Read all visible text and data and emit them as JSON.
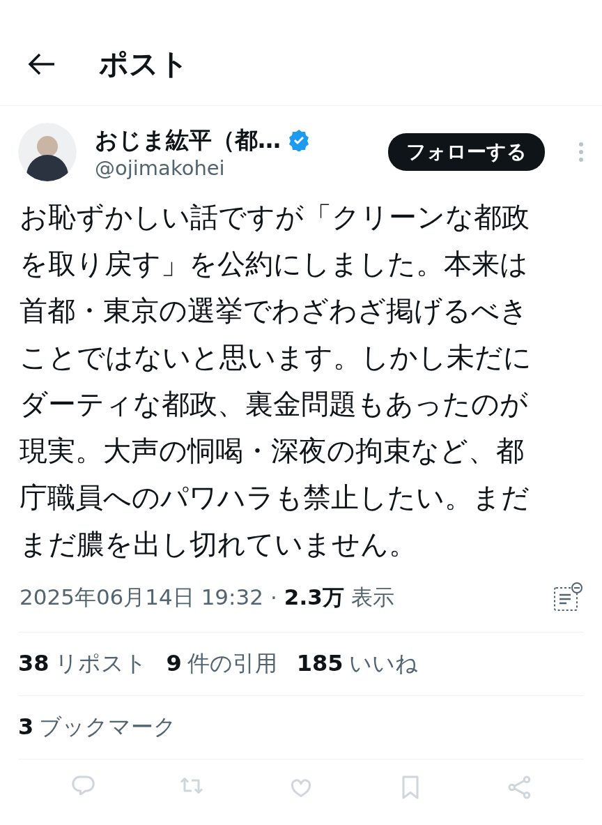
{
  "header": {
    "title": "ポスト"
  },
  "author": {
    "name": "おじま紘平（都…",
    "verified": true,
    "handle": "@ojimakohei",
    "follow_label": "フォローする"
  },
  "body": "お恥ずかしい話ですが「クリーンな都政を取り戻す」を公約にしました。本来は首都・東京の選挙でわざわざ掲げるべきことではないと思います。しかし未だにダーティな都政、裏金問題もあったのが現実。大声の恫喝・深夜の拘束など、都庁職員へのパワハラも禁止したい。まだまだ膿を出し切れていません。",
  "meta": {
    "timestamp": "2025年06月14日 19:32",
    "separator": "·",
    "views": "2.3万",
    "views_label": "表示"
  },
  "stat_rows": [
    [
      {
        "count": "38",
        "label": "リポスト"
      },
      {
        "count": "9",
        "label": "件の引用"
      },
      {
        "count": "185",
        "label": "いいね"
      }
    ],
    [
      {
        "count": "3",
        "label": "ブックマーク"
      }
    ]
  ],
  "actions": [
    {
      "kind": "reply"
    },
    {
      "kind": "repost"
    },
    {
      "kind": "like"
    },
    {
      "kind": "bookmark"
    },
    {
      "kind": "share"
    }
  ]
}
